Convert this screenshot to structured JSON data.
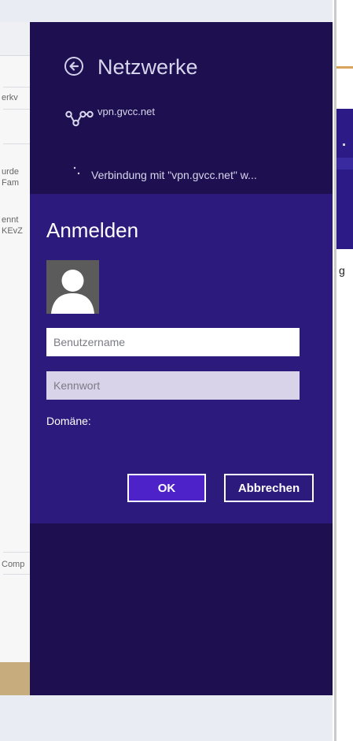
{
  "header": {
    "title": "Netzwerke",
    "network_name": "vpn.gvcc.net",
    "status_text": "Verbindung mit \"vpn.gvcc.net\" w..."
  },
  "dialog": {
    "title": "Anmelden",
    "username_placeholder": "Benutzername",
    "password_placeholder": "Kennwort",
    "domain_label": "Domäne:",
    "ok_label": "OK",
    "cancel_label": "Abbrechen"
  },
  "background": {
    "left_texts": [
      "erkv",
      "urde",
      "Fam",
      "ennt",
      "KEvZ",
      "Comp"
    ],
    "right_text": "g"
  },
  "colors": {
    "panel_dark": "#1d0f50",
    "panel_dialog": "#2c1a7d",
    "ok_button": "#4d22c9",
    "password_field": "#d8d3e9"
  },
  "icons": {
    "back": "back-arrow-circle-icon",
    "network": "vpn-network-icon",
    "avatar": "user-avatar-icon",
    "spinner": "loading-spinner-icon"
  }
}
